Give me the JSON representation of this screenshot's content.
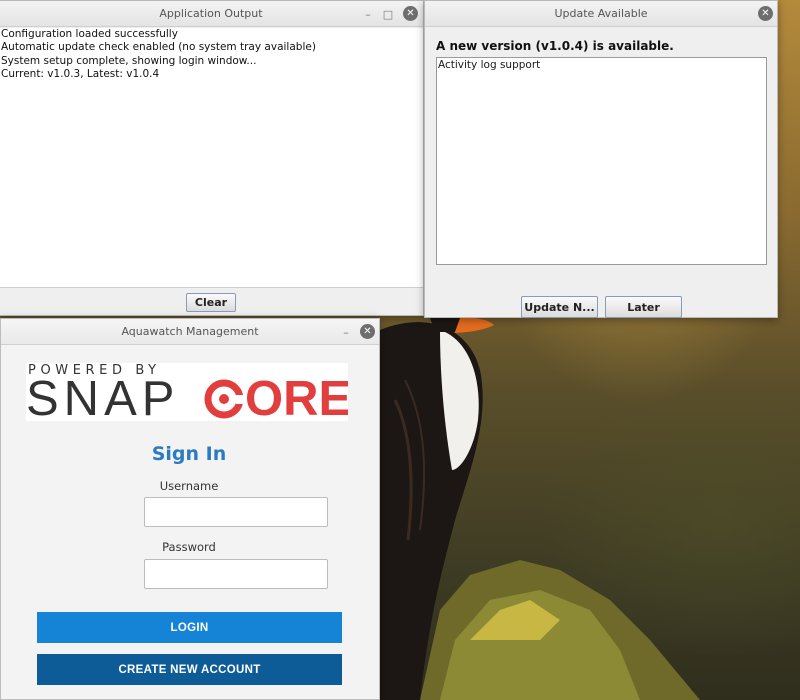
{
  "output_window": {
    "title": "Application Output",
    "lines": [
      "Configuration loaded successfully",
      "Automatic update check enabled (no system tray available)",
      "System setup complete, showing login window...",
      "Current: v1.0.3, Latest: v1.0.4"
    ],
    "clear_label": "Clear",
    "minimize_glyph": "–",
    "maximize_glyph": "□",
    "close_glyph": "✕"
  },
  "update_window": {
    "title": "Update Available",
    "headline": "A new version (v1.0.4) is available.",
    "notes": "Activity log support",
    "update_label": "Update N...",
    "later_label": "Later",
    "close_glyph": "✕"
  },
  "login_window": {
    "title": "Aquawatch Management",
    "logo_powered": "POWERED BY",
    "logo_brand_a": "SNAP",
    "logo_brand_b": "CORE",
    "signin": "Sign In",
    "username_label": "Username",
    "password_label": "Password",
    "username_value": "",
    "password_value": "",
    "login_label": "LOGIN",
    "create_label": "CREATE NEW ACCOUNT",
    "minimize_glyph": "–",
    "close_glyph": "✕"
  },
  "colors": {
    "signin_blue": "#2a7bc0",
    "login_button": "#1583d6",
    "create_button": "#0d5c98",
    "brand_red": "#e23e3e",
    "brand_dark": "#333333"
  }
}
